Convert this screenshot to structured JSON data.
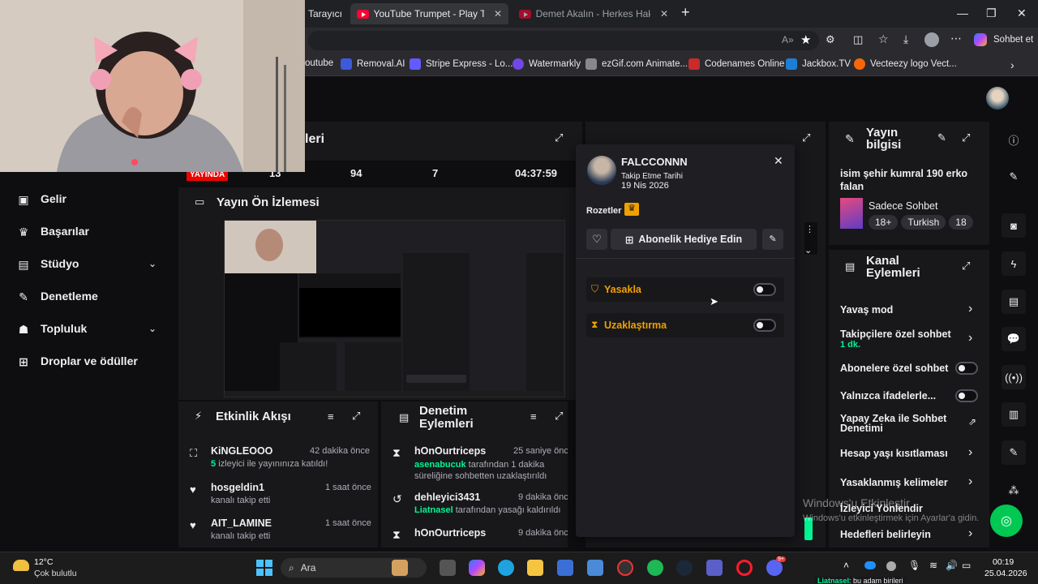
{
  "browser": {
    "tabs": [
      {
        "label": "Tarayıcı"
      },
      {
        "label": "YouTube Trumpet - Play Trumpet v"
      },
      {
        "label": "Demet Akalın - Herkes Hak Ettiği G"
      }
    ],
    "copilot_label": "Sohbet et",
    "bookmarks": [
      "outube",
      "Removal.AI",
      "Stripe Express - Lo...",
      "Watermarkly",
      "ezGif.com Animate...",
      "Codenames Online",
      "Jackbox.TV",
      "Vecteezy logo Vect..."
    ]
  },
  "sidebar": {
    "items": [
      {
        "label": "Gelir",
        "icon": "money-icon"
      },
      {
        "label": "Başarılar",
        "icon": "trophy-icon"
      },
      {
        "label": "Stüdyo",
        "icon": "studio-icon"
      },
      {
        "label": "Denetleme",
        "icon": "wrench-icon"
      },
      {
        "label": "Topluluk",
        "icon": "people-icon"
      },
      {
        "label": "Droplar ve ödüller",
        "icon": "drops-icon"
      }
    ]
  },
  "stats": {
    "partial_title": "leri",
    "live_label": "YAYINDA",
    "v1": "13",
    "v2": "94",
    "v3": "7",
    "uptime": "04:37:59"
  },
  "preview": {
    "title": "Yayın Ön İzlemesi"
  },
  "activity": {
    "title": "Etkinlik Akışı",
    "items": [
      {
        "name": "KiNGLEOOO",
        "time": "42 dakika önce",
        "count": "5",
        "desc": "izleyici ile yayınınıza katıldı!"
      },
      {
        "name": "hosgeldin1",
        "time": "1 saat önce",
        "desc": "kanalı takip etti"
      },
      {
        "name": "AIT_LAMINE",
        "time": "1 saat önce",
        "desc": "kanalı takip etti"
      }
    ]
  },
  "moderation": {
    "title1": "Denetim",
    "title2": "Eylemleri",
    "items": [
      {
        "name": "hOnOurtriceps",
        "time": "25 saniye önc",
        "actor": "asenabucuk",
        "desc": "tarafından 1 dakika süreliğine sohbetten uzaklaştırıldı"
      },
      {
        "name": "dehleyici3431",
        "time": "9 dakika önc",
        "actor": "Liatnasel",
        "desc": "tarafından yasağı kaldırıldı"
      },
      {
        "name": "hOnOurtriceps",
        "time": "9 dakika önc"
      }
    ]
  },
  "popup": {
    "username": "FALCCONNN",
    "follow_label": "Takip Etme Tarihi",
    "follow_date": "19 Nis 2026",
    "badges_label": "Rozetler",
    "gift_button": "Abonelik Hediye Edin",
    "ban_label": "Yasakla",
    "timeout_label": "Uzaklaştırma"
  },
  "stream_info": {
    "title1": "Yayın",
    "title2": "bilgisi",
    "stream_title": "isim şehir kumral 190 erko falan",
    "category": "Sadece Sohbet",
    "tags": [
      "18+",
      "Turkish",
      "18"
    ]
  },
  "channel_actions": {
    "title1": "Kanal",
    "title2": "Eylemleri",
    "items": [
      {
        "label": "Yavaş mod"
      },
      {
        "label": "Takipçilere özel sohbet",
        "sub": "1 dk."
      },
      {
        "label": "Abonelere özel sohbet"
      },
      {
        "label": "Yalnızca ifadelerle..."
      },
      {
        "label": "Yapay Zeka ile Sohbet Denetimi"
      },
      {
        "label": "Hesap yaşı kısıtlaması"
      },
      {
        "label": "Yasaklanmış kelimeler"
      },
      {
        "label": "İzleyici Yönlendir"
      },
      {
        "label": "Hedefleri belirleyin"
      }
    ]
  },
  "watermark": {
    "line1": "Windows'u Etkinleştir",
    "line2": "Windows'u etkinleştirmek için Ayarlar'a gidin."
  },
  "taskbar": {
    "temp": "12°C",
    "weather": "Çok bulutlu",
    "search": "Ara",
    "time": "00:19",
    "date": "25.04.2026",
    "notif_badge": "9+",
    "ticker_name": "Liatnasel",
    "ticker_text": ": bu adam birileri"
  },
  "colors": {
    "bg": "#0e0e10",
    "panel": "#18181b",
    "accent": "#9147ff",
    "live": "#eb0400",
    "green": "#00f593",
    "gold": "#f0a000"
  }
}
